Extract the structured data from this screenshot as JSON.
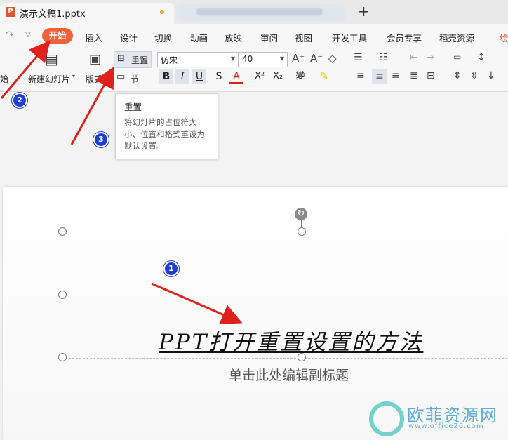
{
  "titlebar": {
    "doc_title": "演示文稿1.pptx",
    "new_tab": "+",
    "app_logo": "P"
  },
  "menu": {
    "items": [
      "开始",
      "插入",
      "设计",
      "切换",
      "动画",
      "放映",
      "审阅",
      "视图",
      "开发工具",
      "会员专享",
      "稻壳资源",
      "绘"
    ],
    "active_color": "#f0613a"
  },
  "ribbon": {
    "start_partial": "始",
    "new_slide": "新建幻灯片",
    "layout": "版式",
    "reset": "重置",
    "section": "节",
    "font_name": "仿宋",
    "font_size": "40",
    "bold": "B",
    "italic": "I",
    "underline": "U",
    "strike": "S",
    "font_color": "A",
    "superscript": "X²",
    "subscript": "X₂",
    "phonetic": "變"
  },
  "tooltip": {
    "title": "重置",
    "description": "将幻灯片的占位符大小、位置和格式重设为默认设置。"
  },
  "slide": {
    "title": "PPT打开重置设置的方法",
    "subtitle": "单击此处编辑副标题"
  },
  "steps": [
    "1",
    "2",
    "3"
  ],
  "watermark": {
    "name": "欧菲资源网",
    "url": "www.office26.com"
  },
  "colors": {
    "arrow": "#e0201b",
    "step_marker": "#1e3fd2"
  }
}
